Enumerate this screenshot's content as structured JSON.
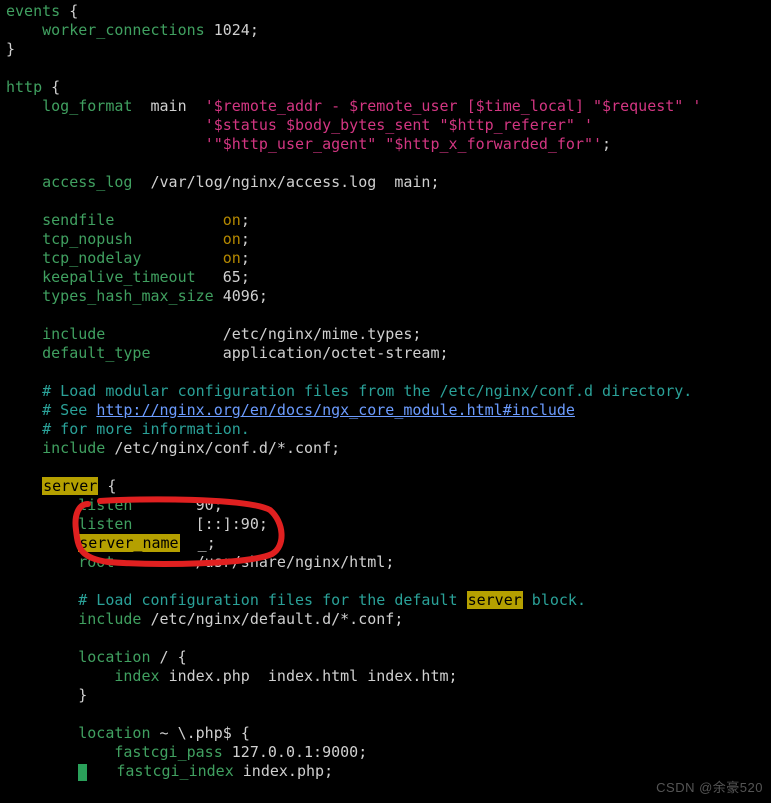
{
  "code": {
    "events_kw": "events",
    "worker_conn_kw": "worker_connections",
    "worker_conn_val": "1024",
    "http_kw": "http",
    "log_format_kw": "log_format",
    "log_format_name": "main",
    "log_fmt1": "'$remote_addr - $remote_user [$time_local] \"$request\" '",
    "log_fmt2": "'$status $body_bytes_sent \"$http_referer\" '",
    "log_fmt3": "'\"$http_user_agent\" \"$http_x_forwarded_for\"'",
    "access_log_kw": "access_log",
    "access_log_path": "/var/log/nginx/access.log",
    "access_log_name": "main",
    "sendfile_kw": "sendfile",
    "tcp_nopush_kw": "tcp_nopush",
    "tcp_nodelay_kw": "tcp_nodelay",
    "on": "on",
    "keepalive_kw": "keepalive_timeout",
    "keepalive_val": "65",
    "types_hash_kw": "types_hash_max_size",
    "types_hash_val": "4096",
    "include_kw": "include",
    "mime_path": "/etc/nginx/mime.types",
    "default_type_kw": "default_type",
    "default_type_val": "application/octet-stream",
    "cmt_load_confd": "# Load modular configuration files from the /etc/nginx/conf.d directory.",
    "cmt_see_prefix": "# See ",
    "cmt_see_url": "http://nginx.org/en/docs/ngx_core_module.html#include",
    "cmt_more_info": "# for more information.",
    "include_confd": "/etc/nginx/conf.d/*.conf",
    "server_kw": "server",
    "listen_kw": "listen",
    "listen_val1": "90",
    "listen_val2": "[::]:90",
    "server_name_kw": "server_name",
    "server_name_val": "_",
    "root_kw": "root",
    "root_val": "/usr/share/nginx/html",
    "cmt_load_default_pre": "# Load configuration files for the default ",
    "cmt_load_default_post": " block.",
    "include_default": "/etc/nginx/default.d/*.conf",
    "location_kw": "location",
    "loc_root_match": "/",
    "index_kw": "index",
    "index_vals": "index.php  index.html index.htm",
    "loc_php_match": "~ \\.php$",
    "fastcgi_pass_kw": "fastcgi_pass",
    "fastcgi_pass_val": "127.0.0.1:9000",
    "fastcgi_index_kw": "fastcgi_index",
    "fastcgi_index_val": "index.php"
  },
  "watermark": "CSDN @余豪520"
}
